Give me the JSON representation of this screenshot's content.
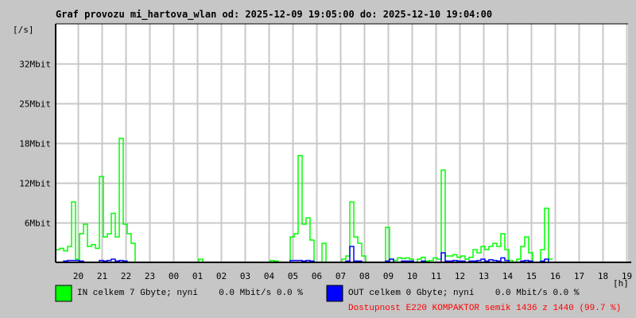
{
  "chart_data": {
    "type": "line",
    "title": "Graf provozu mi_hartova_wlan od: 2025-12-09 19:05:00 do: 2025-12-10 19:04:00",
    "ylabel": "[/s]",
    "xlabel": "[h]",
    "ylim": [
      0,
      37.5
    ],
    "y_unit": "Mbit",
    "y_ticks": [
      {
        "value": 6.25,
        "label": "6Mbit"
      },
      {
        "value": 12.5,
        "label": "12Mbit"
      },
      {
        "value": 18.75,
        "label": "18Mbit"
      },
      {
        "value": 25,
        "label": "25Mbit"
      },
      {
        "value": 31.25,
        "label": "32Mbit"
      }
    ],
    "x_start_minute": 0,
    "x_range_minutes": [
      0,
      1440
    ],
    "x_ticks": [
      "20",
      "21",
      "22",
      "23",
      "00",
      "01",
      "02",
      "03",
      "04",
      "05",
      "06",
      "07",
      "08",
      "09",
      "10",
      "11",
      "12",
      "13",
      "14",
      "15",
      "16",
      "17",
      "18",
      "19"
    ],
    "first_tick_minute": 55,
    "sample_interval_minutes": 10,
    "grid": true,
    "series": [
      {
        "name": "IN",
        "color": "#00ff00",
        "values": [
          2,
          2.2,
          1.8,
          2.5,
          9.5,
          0.5,
          4.5,
          6,
          2.5,
          2.8,
          2.2,
          13.5,
          4,
          4.5,
          7.7,
          4,
          19.5,
          6,
          4.5,
          3,
          0,
          0,
          0,
          0,
          0,
          0,
          0,
          0,
          0,
          0,
          0,
          0,
          0,
          0,
          0,
          0,
          0.5,
          0,
          0,
          0,
          0,
          0,
          0,
          0,
          0,
          0,
          0,
          0,
          0,
          0,
          0,
          0,
          0,
          0,
          0.3,
          0.2,
          0,
          0,
          0,
          4,
          4.5,
          16.8,
          6,
          7,
          3.5,
          0,
          0,
          3,
          0,
          0,
          0,
          0,
          0.5,
          1,
          9.5,
          4,
          3,
          1,
          0,
          0,
          0,
          0,
          0,
          5.5,
          0.5,
          0.3,
          0.7,
          0.6,
          0.7,
          0.5,
          0,
          0.5,
          0.8,
          0.2,
          0.3,
          0.7,
          0.5,
          14.5,
          1,
          1,
          1.2,
          0.8,
          1,
          0.5,
          0.8,
          2,
          1.5,
          2.5,
          2,
          2.5,
          3,
          2.5,
          4.5,
          2,
          0.3,
          0,
          0.5,
          2.5,
          4,
          1.5,
          0,
          0,
          2,
          8.5,
          0.5
        ]
      },
      {
        "name": "OUT",
        "color": "#0000ff",
        "values": [
          0,
          0,
          0.2,
          0.3,
          0.3,
          0.3,
          0.2,
          0,
          0,
          0,
          0,
          0.3,
          0.2,
          0.3,
          0.5,
          0.2,
          0.3,
          0.2,
          0,
          0,
          0,
          0,
          0,
          0,
          0,
          0,
          0,
          0,
          0,
          0,
          0,
          0,
          0,
          0,
          0,
          0,
          0,
          0,
          0,
          0,
          0,
          0,
          0,
          0,
          0,
          0,
          0,
          0,
          0,
          0,
          0,
          0,
          0,
          0,
          0,
          0,
          0,
          0,
          0,
          0.3,
          0.3,
          0.3,
          0.2,
          0.3,
          0.2,
          0,
          0,
          0,
          0,
          0,
          0,
          0,
          0,
          0.2,
          2.5,
          0.2,
          0.2,
          0,
          0,
          0,
          0,
          0,
          0,
          0.2,
          0.5,
          0,
          0,
          0.2,
          0.2,
          0.2,
          0,
          0,
          0.2,
          0,
          0,
          0,
          0,
          1.5,
          0.2,
          0.2,
          0.3,
          0.2,
          0.2,
          0,
          0.2,
          0.2,
          0.3,
          0.5,
          0.2,
          0.4,
          0.3,
          0.2,
          0.7,
          0.3,
          0,
          0,
          0,
          0.2,
          0.3,
          0.2,
          0,
          0,
          0.2,
          0.5,
          0
        ]
      }
    ]
  },
  "legend": {
    "in_color": "#00ff00",
    "out_color": "#0000ff",
    "in_text": "IN celkem 7 Gbyte; nyní    0.0 Mbit/s 0.0 %",
    "out_text": "OUT celkem 0 Gbyte; nyní    0.0 Mbit/s 0.0 %",
    "availability_text": "Dostupnost E220 KOMPAKTOR semik 1436 z 1440 (99.7 %)"
  }
}
